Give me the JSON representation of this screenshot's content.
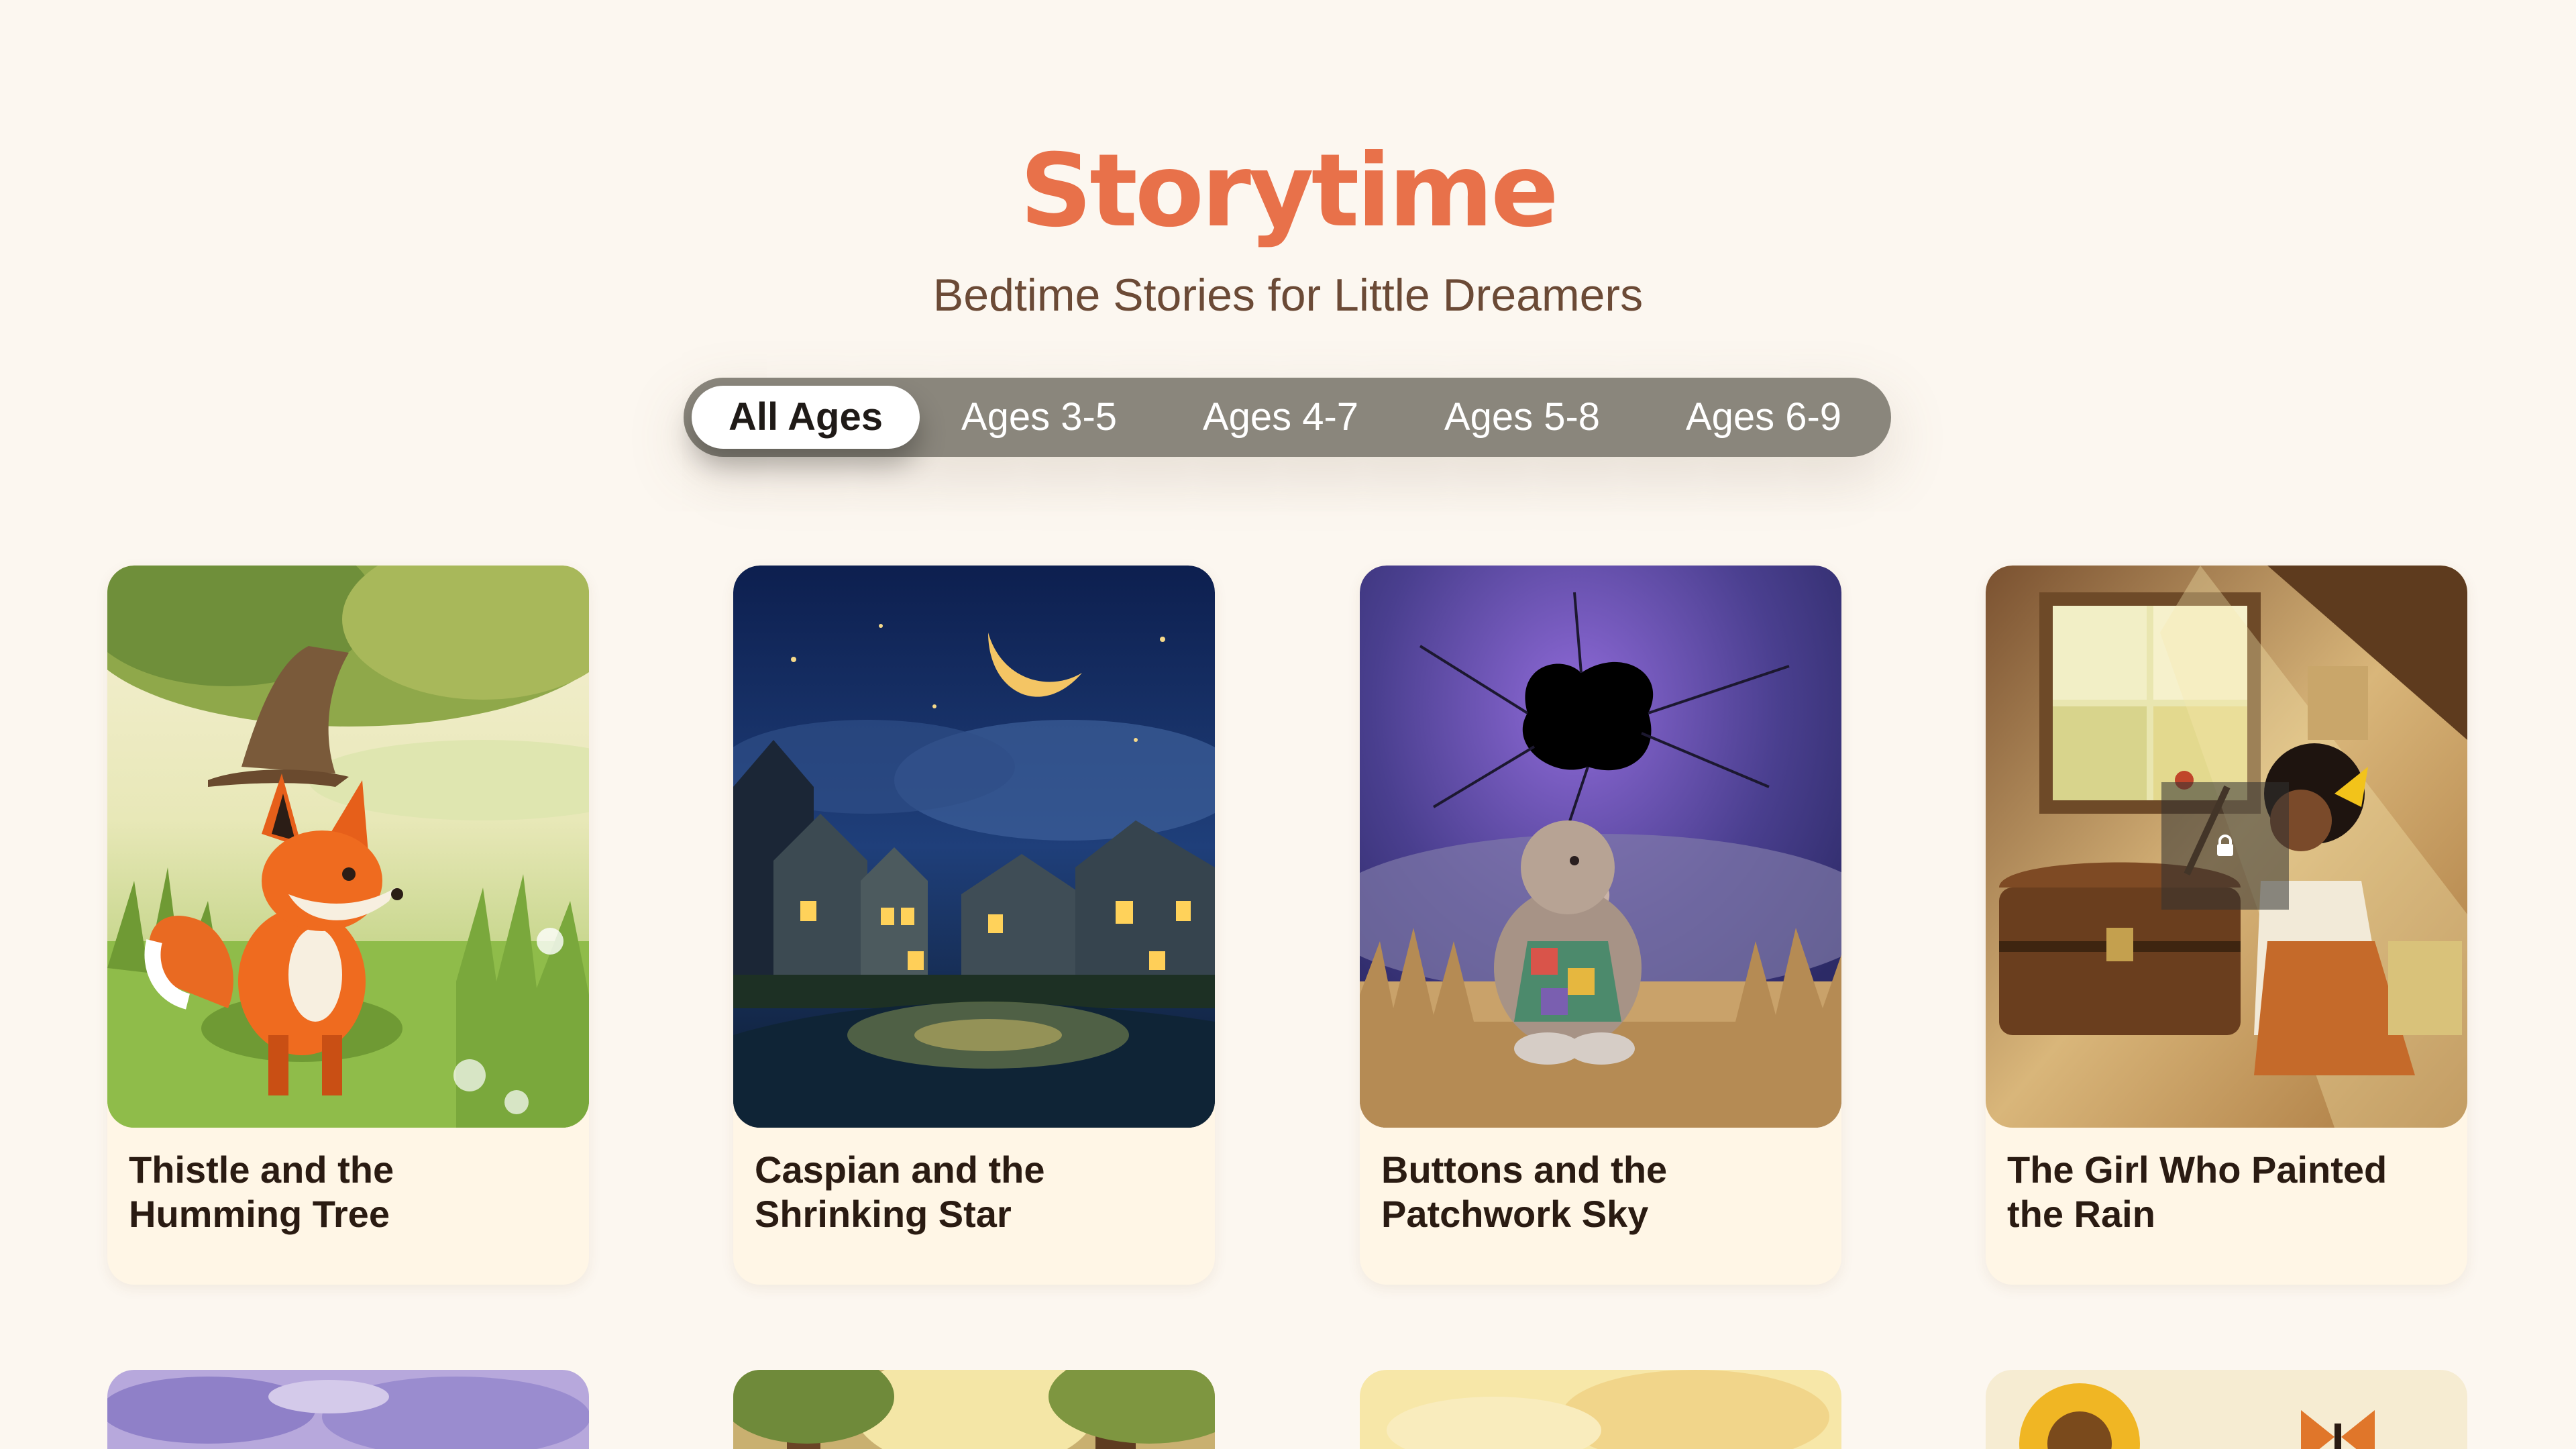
{
  "header": {
    "title": "Storytime",
    "subtitle": "Bedtime Stories for Little Dreamers"
  },
  "age_filter": {
    "selected": "All Ages",
    "options": [
      "All Ages",
      "Ages 3-5",
      "Ages 4-7",
      "Ages 5-8",
      "Ages 6-9"
    ]
  },
  "stories": [
    {
      "title": "Thistle and the Humming Tree",
      "illustration": "fox-under-tree",
      "locked": false
    },
    {
      "title": "Caspian and the Shrinking Star",
      "illustration": "night-village-moon",
      "locked": false
    },
    {
      "title": "Buttons and the Patchwork Sky",
      "illustration": "rabbit-dark-hole-sky",
      "locked": false
    },
    {
      "title": "The Girl Who Painted the Rain",
      "illustration": "girl-painting-attic",
      "locked": true
    }
  ],
  "next_row_illustrations": [
    "lavender-sky",
    "forest-sun",
    "golden-haze",
    "sunflower-butterfly"
  ],
  "colors": {
    "accent": "#e8714a",
    "subtitle": "#6b4a36",
    "background": "#fcf7f0",
    "card": "#fff6e6",
    "filter_bar": "#8a867c"
  },
  "icons": {
    "lock": "lock-icon"
  }
}
